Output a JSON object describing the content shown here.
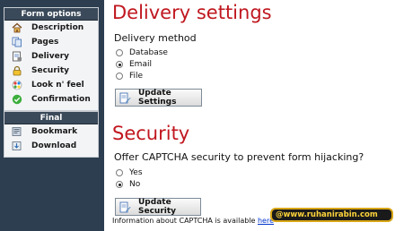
{
  "sidebar": {
    "options_header": "Form options",
    "final_header": "Final",
    "options_items": [
      {
        "label": "Description",
        "icon": "house-icon"
      },
      {
        "label": "Pages",
        "icon": "pages-icon"
      },
      {
        "label": "Delivery",
        "icon": "delivery-icon"
      },
      {
        "label": "Security",
        "icon": "lock-icon"
      },
      {
        "label": "Look n' feel",
        "icon": "palette-icon"
      },
      {
        "label": "Confirmation",
        "icon": "check-icon"
      }
    ],
    "final_items": [
      {
        "label": "Bookmark",
        "icon": "bookmark-icon"
      },
      {
        "label": "Download",
        "icon": "download-icon"
      }
    ]
  },
  "delivery": {
    "title": "Delivery settings",
    "question": "Delivery method",
    "options": [
      "Database",
      "Email",
      "File"
    ],
    "selected": "Email",
    "button": "Update Settings"
  },
  "security": {
    "title": "Security",
    "question": "Offer CAPTCHA security to prevent form hijacking?",
    "options": [
      "Yes",
      "No"
    ],
    "selected": "No",
    "button": "Update Security",
    "info_prefix": "Information about CAPTCHA is available ",
    "info_link": "here"
  },
  "watermark": "@www.ruhanirabin.com",
  "colors": {
    "sidebar_bg": "#2c3e50",
    "heading_red": "#c0171f",
    "link_blue": "#0033cc",
    "watermark_gold": "#ffd43b"
  }
}
